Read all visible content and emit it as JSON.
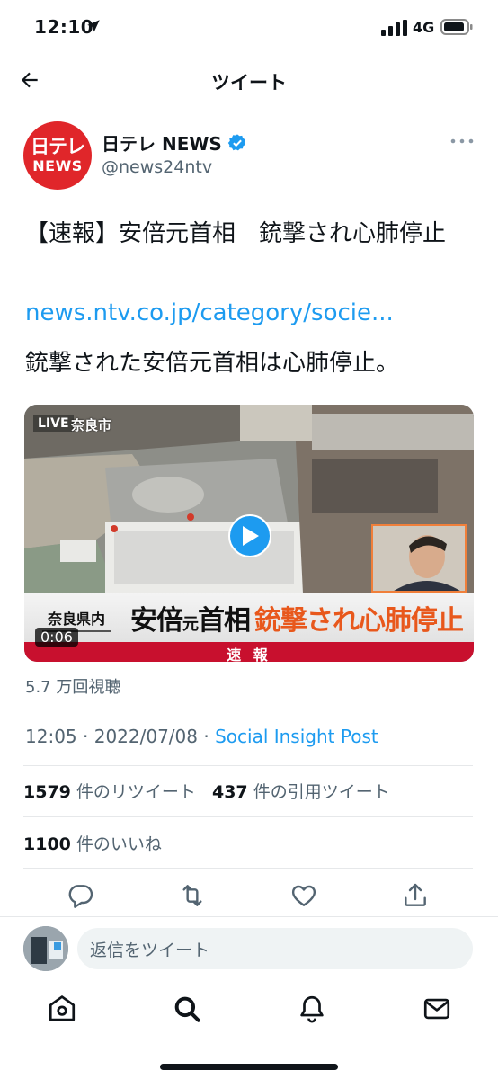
{
  "status_bar": {
    "time": "12:10",
    "network": "4G"
  },
  "header": {
    "title": "ツイート"
  },
  "author": {
    "avatar_text_top": "日テレ",
    "avatar_text_bottom": "NEWS",
    "name": "日テレ NEWS",
    "handle": "@news24ntv",
    "brand_color": "#e0262a"
  },
  "tweet": {
    "text": "【速報】安倍元首相　銃撃され心肺停止",
    "link": "news.ntv.co.jp/category/socie...",
    "text2": "銃撃された安倍元首相は心肺停止。",
    "link_color": "#1d9bf0"
  },
  "media": {
    "live_label": "LIVE",
    "city_label": "奈良市",
    "banner_prefecture": "奈良県内",
    "banner_name_a": "安倍",
    "banner_name_b": "元",
    "banner_name_c": "首相",
    "banner_headline": "銃撃され心肺停止",
    "flash_label": "速 報",
    "duration": "0:06"
  },
  "views": "5.7 万回視聴",
  "meta": {
    "time": "12:05",
    "date": "2022/07/08",
    "separator": " · ",
    "via": "Social Insight Post"
  },
  "stats": {
    "retweets_count": "1579",
    "retweets_label": " 件のリツイート",
    "quotes_count": "437",
    "quotes_label": " 件の引用ツイート",
    "likes_count": "1100",
    "likes_label": " 件のいいね"
  },
  "actions": [
    "reply-icon",
    "retweet-icon",
    "like-icon",
    "share-icon"
  ],
  "reply": {
    "placeholder": "返信をツイート"
  },
  "tabbar": [
    "home-icon",
    "search-icon",
    "notifications-icon",
    "messages-icon"
  ]
}
